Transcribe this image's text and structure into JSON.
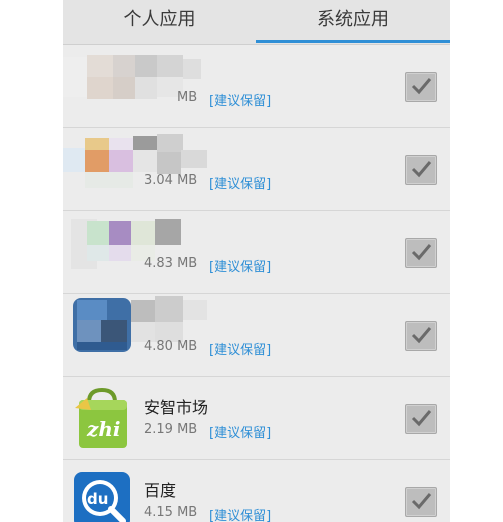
{
  "tabs": {
    "personal_label": "个人应用",
    "system_label": "系统应用",
    "active": "system"
  },
  "apps": [
    {
      "name": "",
      "size": "MB",
      "tag": "[建议保留]",
      "checked": true,
      "icon": "pixelated-icon"
    },
    {
      "name": "",
      "size": "3.04 MB",
      "tag": "[建议保留]",
      "checked": true,
      "icon": "pixelated-icon"
    },
    {
      "name": "",
      "size": "4.83 MB",
      "tag": "[建议保留]",
      "checked": true,
      "icon": "pixelated-icon"
    },
    {
      "name": "",
      "size": "4.80 MB",
      "tag": "[建议保留]",
      "checked": true,
      "icon": "pixelated-icon"
    },
    {
      "name": "安智市场",
      "size": "2.19 MB",
      "tag": "[建议保留]",
      "checked": true,
      "icon": "anzhi-market-icon"
    },
    {
      "name": "百度",
      "size": "4.15 MB",
      "tag": "[建议保留]",
      "checked": true,
      "icon": "baidu-icon"
    }
  ],
  "colors": {
    "accent": "#2f8fd6",
    "tag": "#2f8fd6",
    "anzhi_green": "#8cc63f",
    "baidu_blue": "#1d6fc2"
  }
}
